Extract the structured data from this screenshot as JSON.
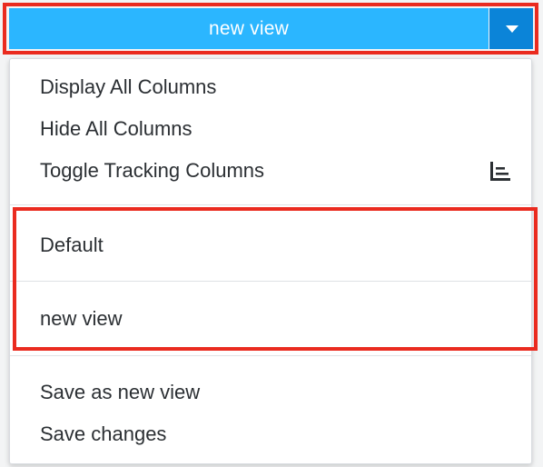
{
  "view_selector": {
    "current_view_label": "new view",
    "caret_icon": "caret-down-icon"
  },
  "menu": {
    "column_actions": [
      {
        "label": "Display All Columns"
      },
      {
        "label": "Hide All Columns"
      },
      {
        "label": "Toggle Tracking Columns",
        "icon": "tracking-columns-icon"
      }
    ],
    "views": [
      {
        "label": "Default"
      },
      {
        "label": "new view"
      }
    ],
    "save_actions": [
      {
        "label": "Save as new view"
      },
      {
        "label": "Save changes"
      }
    ]
  },
  "colors": {
    "button_primary": "#2bb6ff",
    "button_caret": "#0b84d8",
    "highlight": "#ea2b1f"
  }
}
